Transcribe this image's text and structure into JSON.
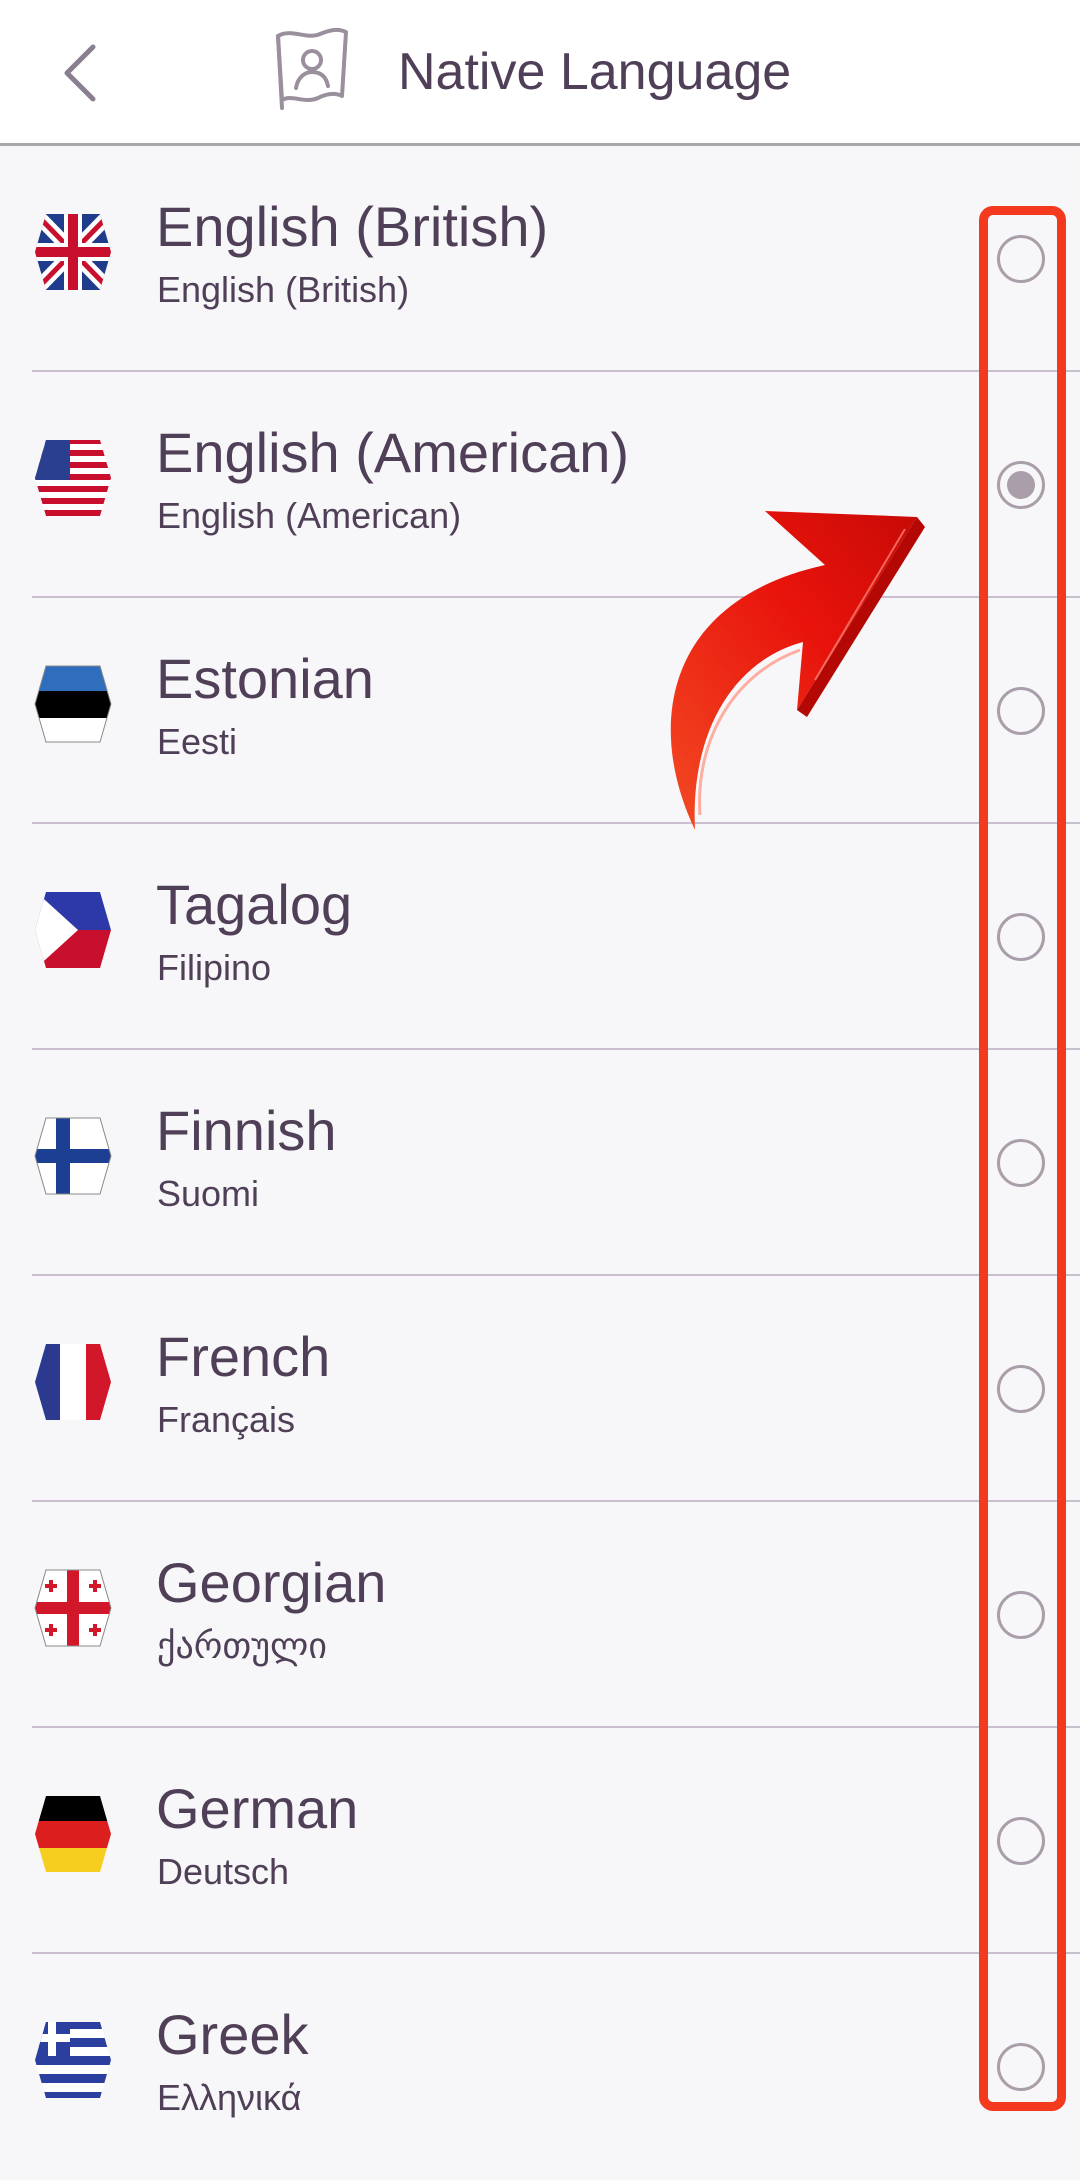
{
  "header": {
    "title": "Native Language",
    "back_icon": "chevron-left-icon",
    "title_icon": "language-flag-person-icon"
  },
  "languages": [
    {
      "name": "English (British)",
      "native": "English (British)",
      "flag": "uk-flag-icon",
      "selected": false
    },
    {
      "name": "English (American)",
      "native": "English (American)",
      "flag": "us-flag-icon",
      "selected": true
    },
    {
      "name": "Estonian",
      "native": "Eesti",
      "flag": "estonia-flag-icon",
      "selected": false
    },
    {
      "name": "Tagalog",
      "native": "Filipino",
      "flag": "philippines-flag-icon",
      "selected": false
    },
    {
      "name": "Finnish",
      "native": "Suomi",
      "flag": "finland-flag-icon",
      "selected": false
    },
    {
      "name": "French",
      "native": "Français",
      "flag": "france-flag-icon",
      "selected": false
    },
    {
      "name": "Georgian",
      "native": "ქართული",
      "flag": "georgia-flag-icon",
      "selected": false
    },
    {
      "name": "German",
      "native": "Deutsch",
      "flag": "germany-flag-icon",
      "selected": false
    },
    {
      "name": "Greek",
      "native": "Ελληνικά",
      "flag": "greece-flag-icon",
      "selected": false
    }
  ],
  "colors": {
    "text": "#4f3f57",
    "radio": "#a99ea9",
    "highlight": "#f33a1f",
    "arrow": "#e8130c"
  }
}
